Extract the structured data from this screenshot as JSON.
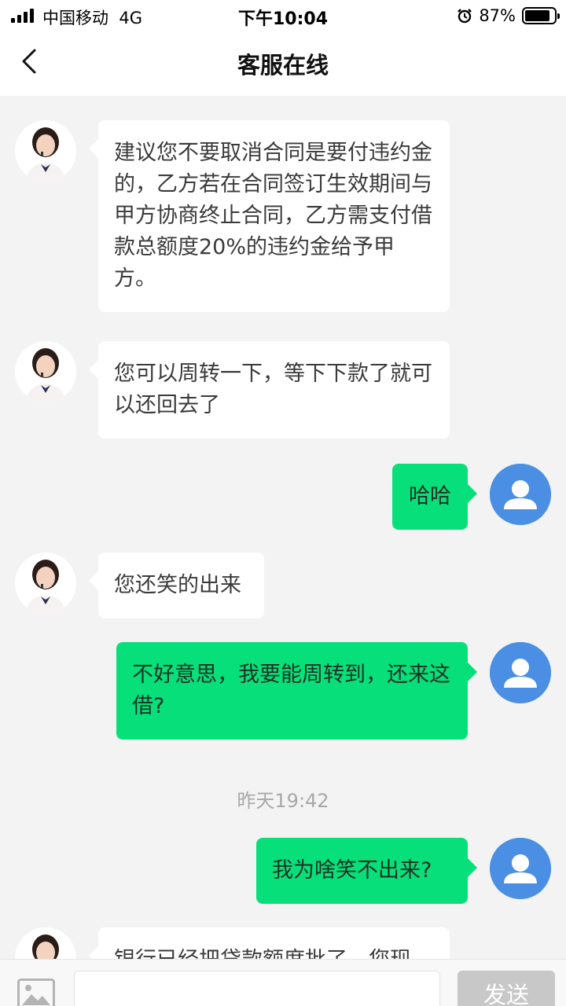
{
  "status_bar": {
    "carrier": "中国移动",
    "network": "4G",
    "time": "下午10:04",
    "battery": "87%",
    "battery_level": 0.87
  },
  "nav": {
    "title": "客服在线",
    "back_icon": "chevron-left-icon"
  },
  "messages": [
    {
      "sender": "agent",
      "text": "建议您不要取消合同是要付违约金的，乙方若在合同签订生效期间与甲方协商终止合同，乙方需支付借款总额度20%的违约金给予甲方。"
    },
    {
      "sender": "agent",
      "text": "您可以周转一下，等下下款了就可以还回去了"
    },
    {
      "sender": "user",
      "text": "哈哈"
    },
    {
      "sender": "agent",
      "text": "您还笑的出来"
    },
    {
      "sender": "user",
      "text": "不好意思，我要能周转到，还来这借?"
    },
    {
      "sender": "timestamp",
      "text": "昨天19:42"
    },
    {
      "sender": "user",
      "text": "我为啥笑不出来?"
    },
    {
      "sender": "agent",
      "text": "银行已经把贷款额度批了，您现"
    }
  ],
  "composer": {
    "image_icon": "image-icon",
    "input_value": "",
    "input_placeholder": "",
    "send_label": "发送"
  },
  "colors": {
    "user_bubble": "#07e07a",
    "agent_bubble": "#ffffff",
    "chat_background": "#f3f3f3",
    "user_avatar": "#4a90e2",
    "send_button_disabled": "#c8c8c8"
  }
}
